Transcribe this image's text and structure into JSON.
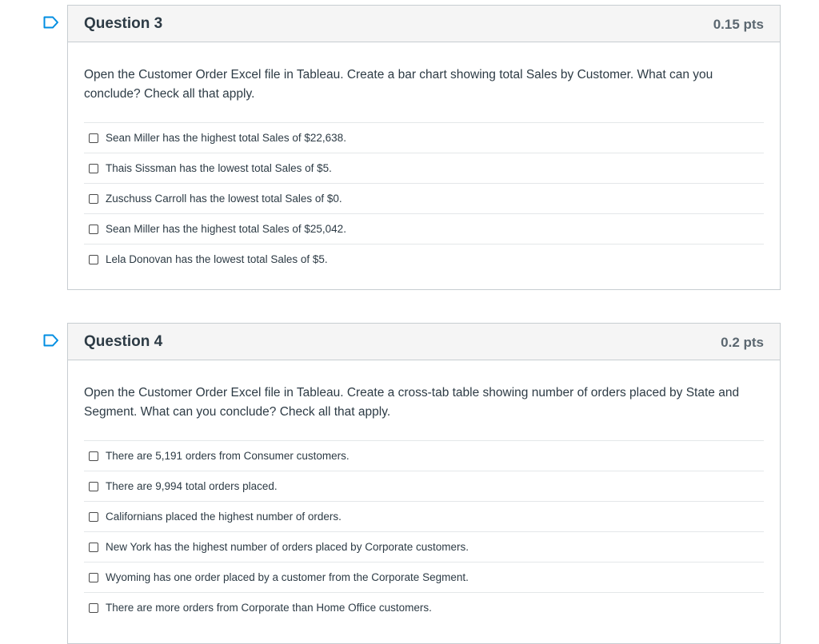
{
  "questions": [
    {
      "title": "Question 3",
      "points": "0.15 pts",
      "text": "Open the Customer Order Excel file in Tableau. Create a bar chart showing total Sales by Customer.  What can you conclude?  Check all that apply.",
      "answers": [
        "Sean Miller has the highest total Sales of $22,638.",
        "Thais Sissman has the lowest total Sales of $5.",
        "Zuschuss Carroll has the lowest total Sales of $0.",
        "Sean Miller has the highest total Sales of $25,042.",
        "Lela Donovan has the lowest total Sales of $5."
      ]
    },
    {
      "title": "Question 4",
      "points": "0.2 pts",
      "text": "Open the Customer Order Excel file in Tableau.  Create a cross-tab table showing number of orders placed by State and Segment.  What can you conclude?  Check all that apply.",
      "answers": [
        "There are 5,191 orders from Consumer customers.",
        "There are 9,994 total orders placed.",
        "Californians placed the highest number of orders.",
        "New York has the highest number of orders placed by Corporate customers.",
        "Wyoming has one order placed by a customer from the Corporate Segment.",
        "There are more orders from Corporate than Home Office customers."
      ]
    }
  ],
  "colors": {
    "flag": "#008ee2",
    "header_bg": "#f5f5f5",
    "border": "#c7cdd1",
    "text": "#2d3b45"
  },
  "icons": {
    "flag": "flag-icon",
    "checkbox": "checkbox-icon"
  }
}
